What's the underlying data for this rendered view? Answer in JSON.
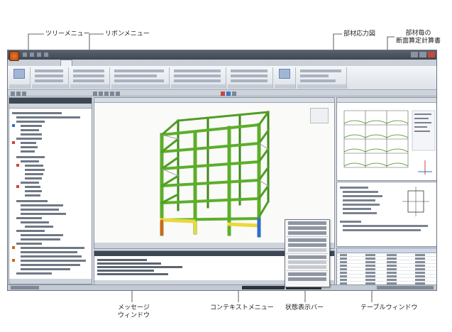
{
  "callouts": {
    "tree_menu": "ツリーメニュー",
    "ribbon_menu": "リボンメニュー",
    "member_stress": "部材応力図",
    "section_calc_line1": "部材毎の",
    "section_calc_line2": "断面算定計算書",
    "message_window_line1": "メッセージ",
    "message_window_line2": "ウィンドウ",
    "context_menu": "コンテキストメニュー",
    "status_bar": "状態表示バー",
    "table_window": "テーブルウィンドウ"
  },
  "colors": {
    "frame_green": "#5dae2a",
    "frame_dark_green": "#3d8a1c",
    "stress_yellow": "#e9d93a",
    "stress_blue": "#2f6bd0",
    "app_button": "#d4621f",
    "panel_title": "#3e4754"
  },
  "icons": {
    "app": "app-menu-icon",
    "view_cube": "view-cube-icon",
    "close": "close-icon"
  }
}
